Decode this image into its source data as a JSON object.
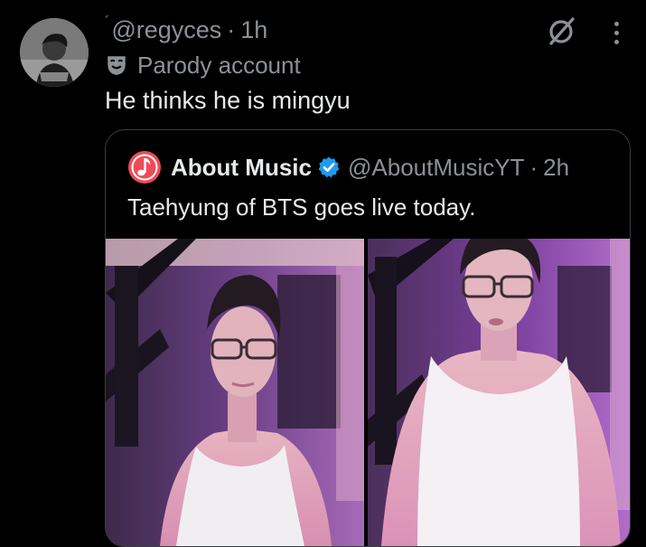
{
  "tweet": {
    "handle": "@regyces",
    "time": "1h",
    "badge_label": "Parody account",
    "text": "He thinks he is mingyu"
  },
  "quoted": {
    "name": "About Music",
    "handle": "@AboutMusicYT",
    "time": "2h",
    "text": "Taehyung of BTS goes live today."
  },
  "icons": {
    "avatar": "avatar",
    "parody": "theater-mask-icon",
    "hide": "hide-icon",
    "more": "more-options-icon",
    "music_logo": "music-note-icon",
    "verified": "verified-badge-icon"
  },
  "colors": {
    "background": "#000000",
    "muted_text": "#8b9196",
    "verified_blue": "#1d9bf0",
    "music_logo_red": "#ef4b57"
  }
}
